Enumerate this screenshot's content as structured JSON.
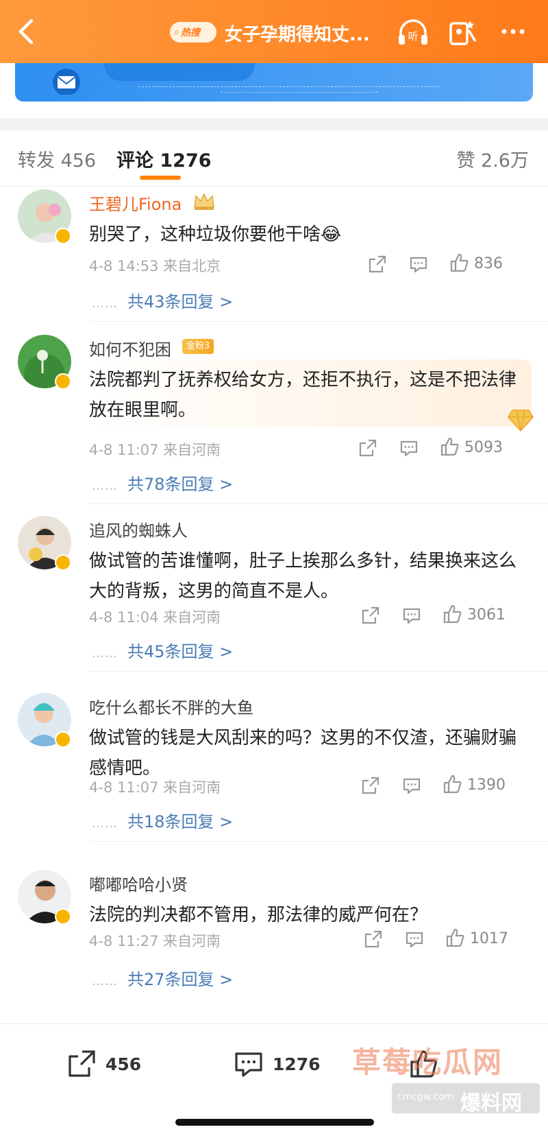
{
  "header": {
    "hot_label": "热搜",
    "title": "女子孕期得知丈..."
  },
  "tabs": {
    "repost": "转发 456",
    "comment": "评论 1276",
    "like": "赞 2.6万"
  },
  "comments": [
    {
      "user": "王碧儿Fiona",
      "text": "别哭了，这种垃圾你要他干啥😂",
      "meta": "4-8 14:53  来自北京",
      "likes": "836",
      "replies": "共43条回复 >"
    },
    {
      "user": "如何不犯困",
      "badge": "金粉3",
      "text": "法院都判了抚养权给女方，还拒不执行，这是不把法律放在眼里啊。",
      "meta": "4-8 11:07  来自河南",
      "likes": "5093",
      "replies": "共78条回复 >"
    },
    {
      "user": "追风的蜘蛛人",
      "text": "做试管的苦谁懂啊，肚子上挨那么多针，结果换来这么大的背叛，这男的简直不是人。",
      "meta": "4-8 11:04  来自河南",
      "likes": "3061",
      "replies": "共45条回复 >"
    },
    {
      "user": "吃什么都长不胖的大鱼",
      "text": "做试管的钱是大风刮来的吗？这男的不仅渣，还骗财骗感情吧。",
      "meta": "4-8 11:07  来自河南",
      "likes": "1390",
      "replies": "共18条回复 >"
    },
    {
      "user": "嘟嘟哈哈小贤",
      "text": "法院的判决都不管用，那法律的威严何在？",
      "meta": "4-8 11:27  来自河南",
      "likes": "1017",
      "replies": "共27条回复 >"
    }
  ],
  "bottom_bar": {
    "repost_count": "456",
    "comment_count": "1276"
  },
  "watermark": {
    "site_name": "草莓吃瓜网",
    "domain": "cmcgw.com",
    "brand": "爆料网"
  },
  "colors": {
    "header_orange": "#ff8a2b",
    "accent": "#ff8200",
    "link_blue": "#4a7bb5",
    "vip_name": "#f0661e"
  }
}
